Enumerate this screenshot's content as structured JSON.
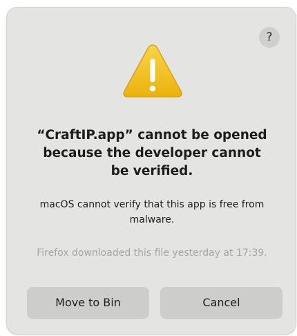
{
  "dialog": {
    "help_label": "?",
    "icon": "warning-triangle-icon",
    "title": "“CraftIP.app” cannot be opened because the developer cannot be verified.",
    "message": "macOS cannot verify that this app is free from malware.",
    "footnote": "Firefox downloaded this file yesterday at 17:39.",
    "buttons": {
      "move_to_bin": "Move to Bin",
      "cancel": "Cancel"
    }
  },
  "colors": {
    "dialog_background": "#e4e4e3",
    "button_background": "#cdcdcc",
    "warning_yellow": "#f2c21b",
    "footnote_text": "#a6a6a6"
  }
}
